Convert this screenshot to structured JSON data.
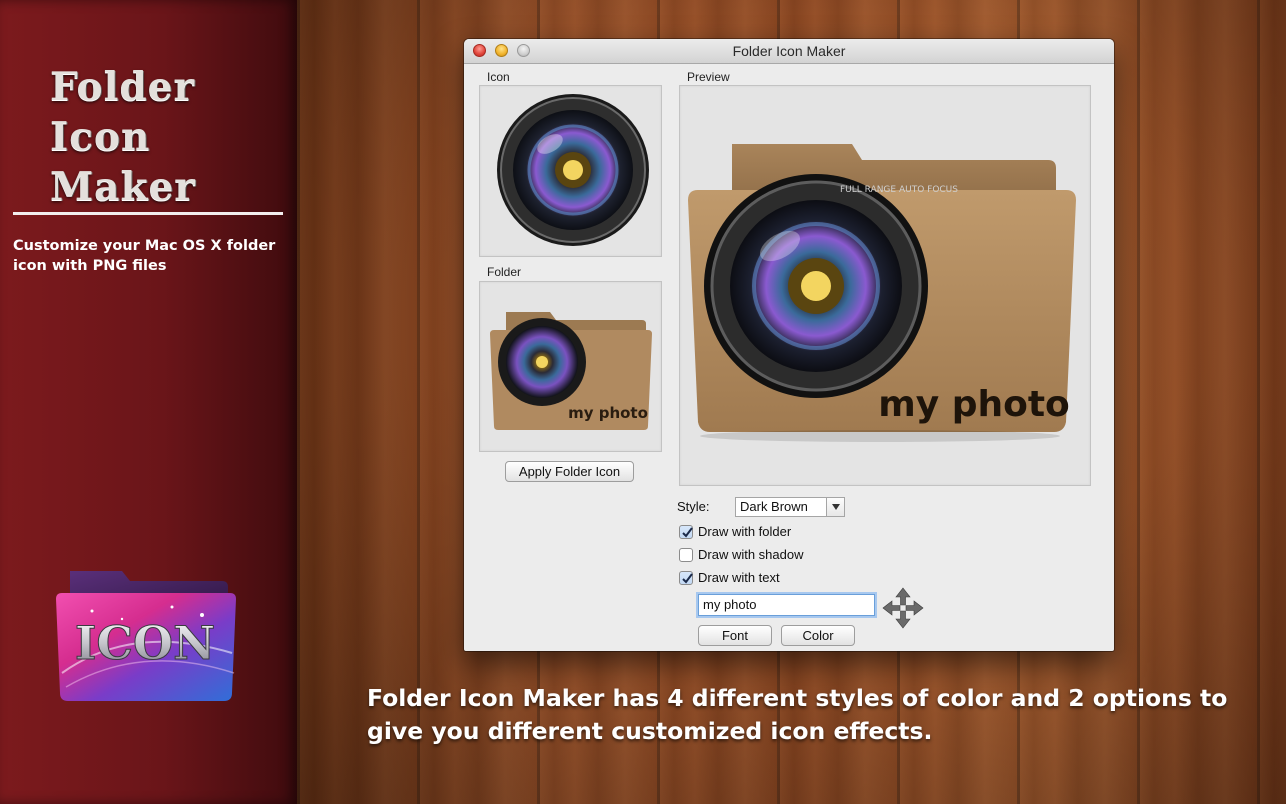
{
  "promo": {
    "title_lines": [
      "Folder",
      "Icon",
      "Maker"
    ],
    "tagline": "Customize your Mac OS X folder icon with PNG files",
    "badge_text": "ICON"
  },
  "caption": "Folder Icon Maker has 4 different styles of color and 2 options to give you different customized icon effects.",
  "window": {
    "title": "Folder Icon Maker",
    "icon_label": "Icon",
    "folder_label": "Folder",
    "preview_label": "Preview",
    "apply_button": "Apply Folder Icon",
    "style_label": "Style:",
    "style_value": "Dark Brown",
    "options": [
      {
        "label": "Draw with folder",
        "checked": true
      },
      {
        "label": "Draw with shadow",
        "checked": false
      },
      {
        "label": "Draw with text",
        "checked": true
      }
    ],
    "text_value": "my photo",
    "font_button": "Font",
    "color_button": "Color",
    "folder_text": "my photo",
    "lens_text": "FULL RANGE AUTO FOCUS"
  },
  "colors": {
    "promo_red": "#6a1519",
    "wood": "#a0542a",
    "folder_brown": "#b08a60",
    "lens_purple": "#8a5ad0"
  }
}
